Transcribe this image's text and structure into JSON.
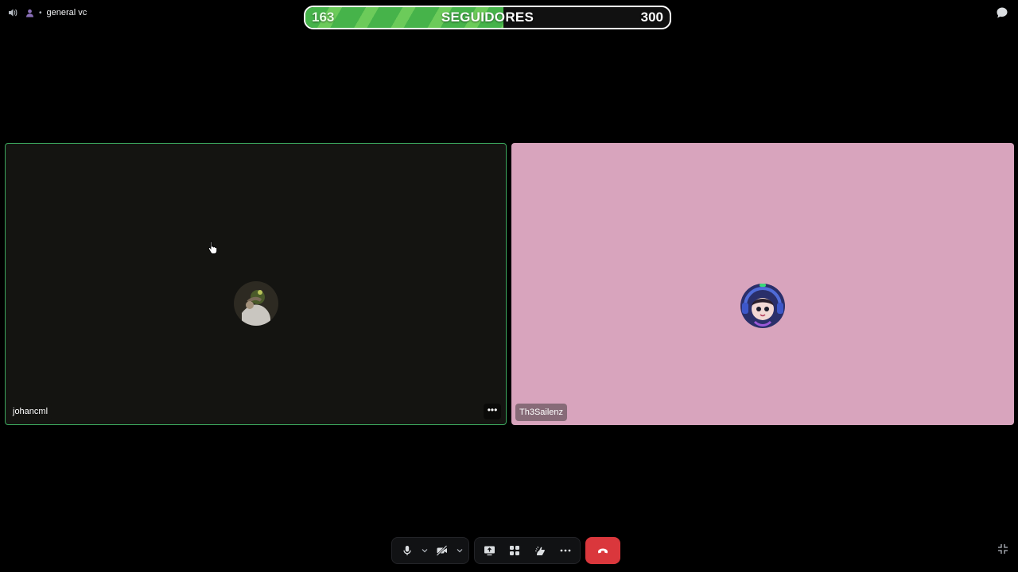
{
  "header": {
    "channel_name": "general vc",
    "separator": "•"
  },
  "follower_goal": {
    "current": "163",
    "label": "SEGUIDORES",
    "target": "300",
    "progress_fraction": 0.543,
    "fill_color": "#46b34a"
  },
  "participants": [
    {
      "name": "johancml",
      "tile_color": "#141411",
      "speaking_border": "#3ba55c",
      "avatar_icon": "user-avatar-photo"
    },
    {
      "name": "Th3Sailenz",
      "tile_color": "#d8a4bd",
      "avatar_icon": "anime-avatar-headphones"
    }
  ],
  "tile_menu_label": "•••",
  "controls": {
    "mic_icon": "microphone-icon",
    "camera_icon": "camera-off-icon",
    "screen_share_icon": "screen-share-icon",
    "activities_icon": "activities-icon",
    "soundboard_icon": "soundboard-icon",
    "more_icon": "more-icon",
    "end_call_icon": "phone-hangup-icon",
    "end_call_color": "#da373c"
  }
}
